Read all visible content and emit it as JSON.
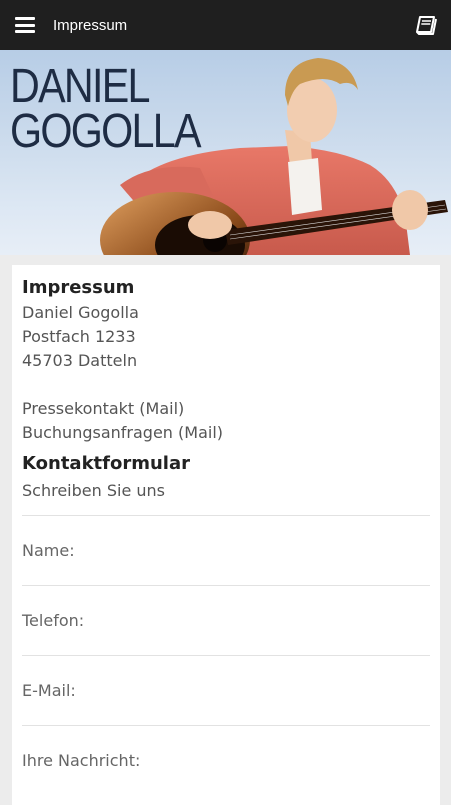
{
  "appbar": {
    "title": "Impressum",
    "menu_icon": "menu-icon",
    "book_icon": "book-icon"
  },
  "hero": {
    "name_line1": "DANIEL",
    "name_line2": "GOGOLLA",
    "colors": {
      "sky": "#c9d9eb",
      "name": "#1e2c44",
      "shirt": "#e36a60"
    }
  },
  "content": {
    "impressum_heading": "Impressum",
    "address_name": "Daniel Gogolla",
    "address_postfach": "Postfach 1233",
    "address_city": "45703 Datteln",
    "presse_link": "Pressekontakt (Mail)",
    "buchung_link": "Buchungsanfragen (Mail)",
    "form_heading": "Kontaktformular",
    "form_subtitle": "Schreiben Sie uns"
  },
  "form": {
    "name_label": "Name:",
    "phone_label": "Telefon:",
    "email_label": "E-Mail:",
    "message_label": "Ihre Nachricht:"
  }
}
